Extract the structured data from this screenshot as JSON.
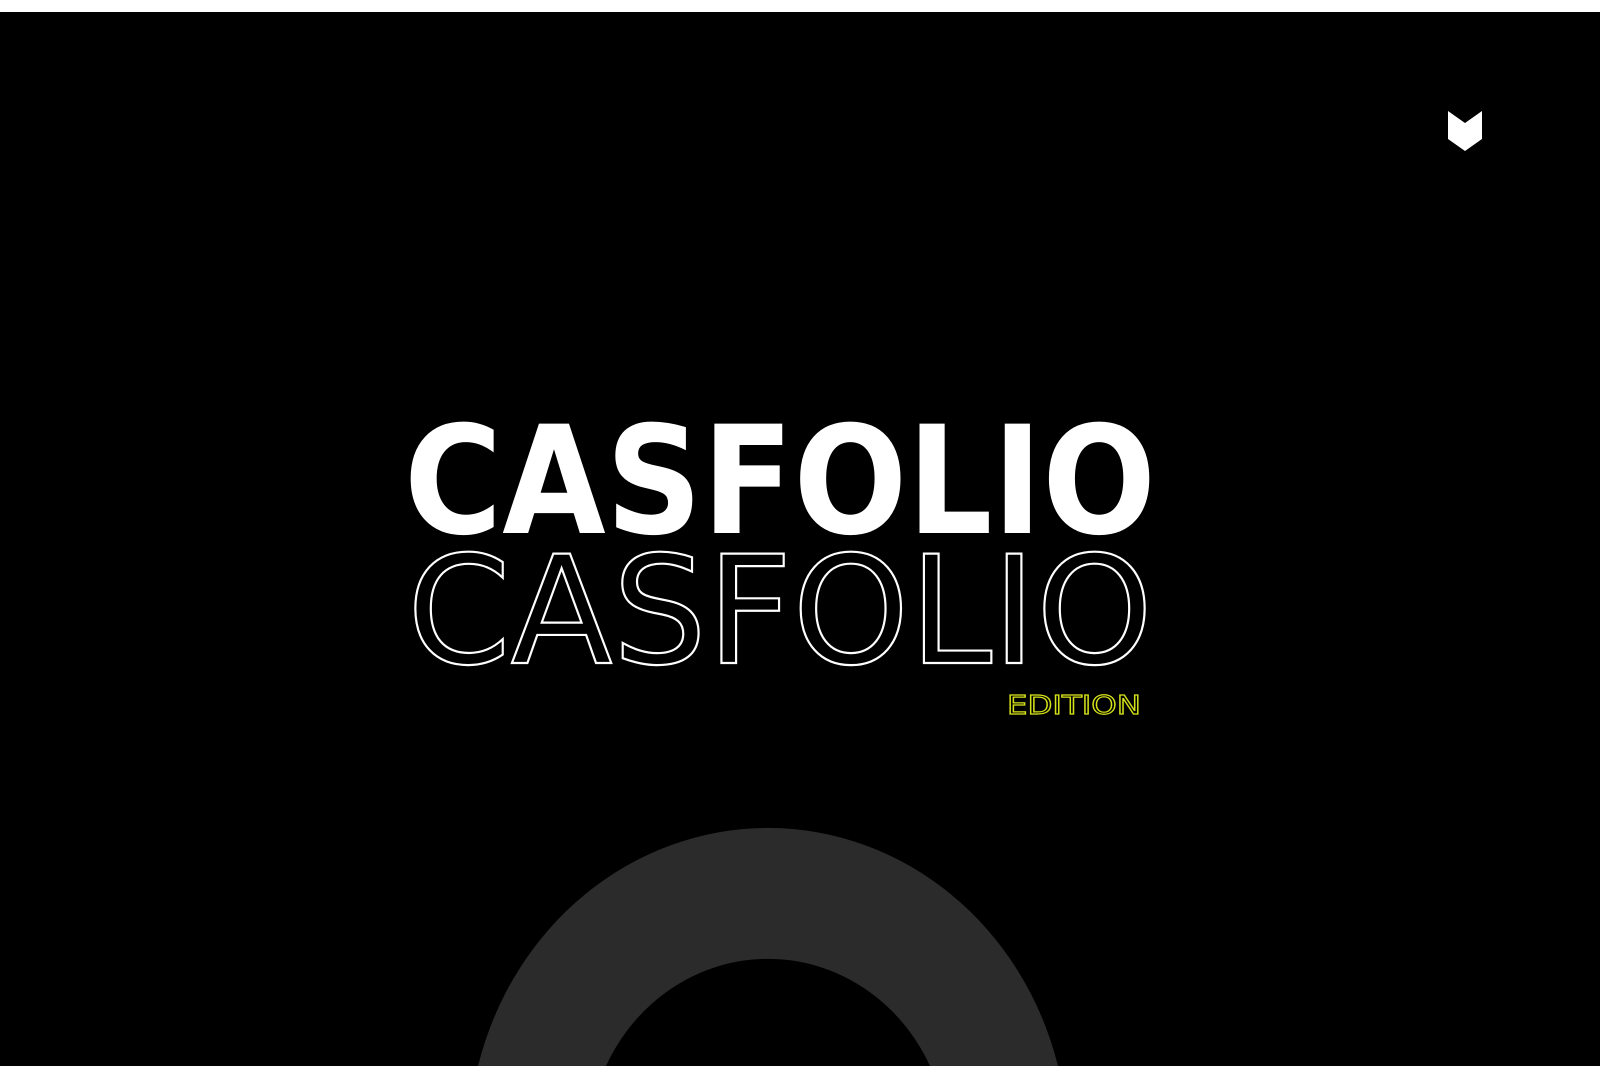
{
  "brand": {
    "title_bold": "CASFOLIO",
    "title_outline": "CASFOLIO",
    "subtitle": "EDITION"
  },
  "logo": {
    "icon": "chevron-mark-icon"
  },
  "colors": {
    "background": "#000000",
    "text": "#ffffff",
    "accent": "#d4e21a",
    "decorative_ring": "#2b2b2b"
  }
}
